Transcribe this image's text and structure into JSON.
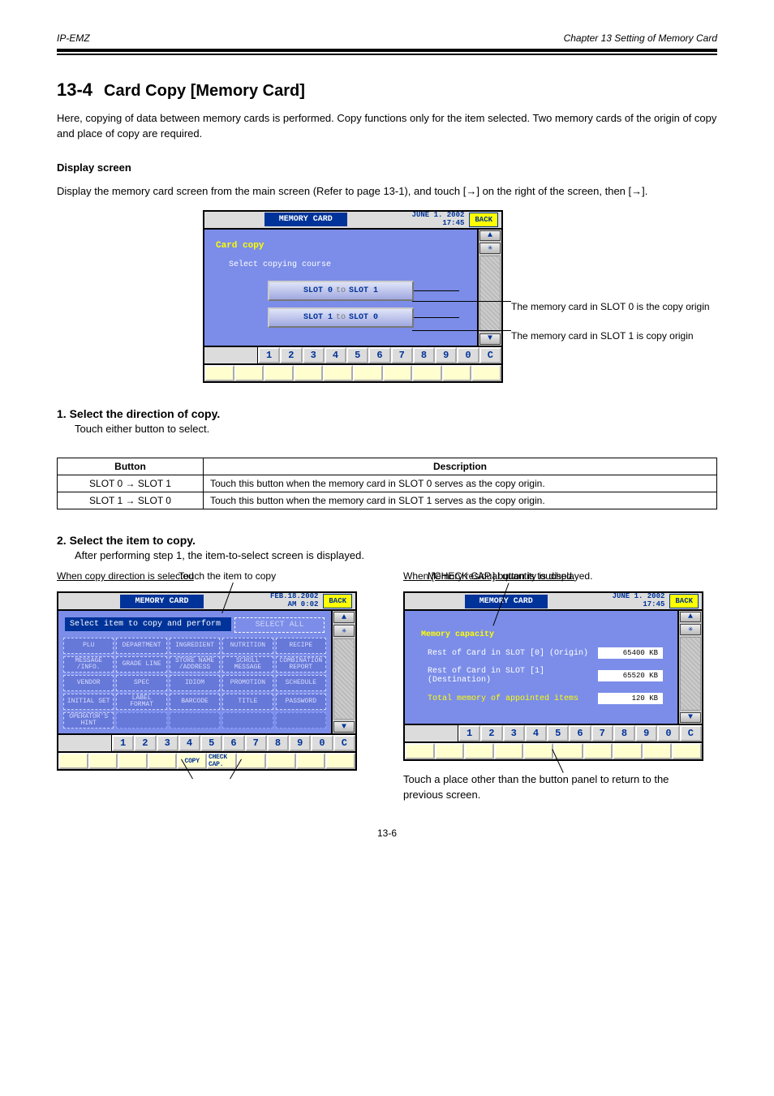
{
  "header": {
    "left": "IP-EMZ",
    "right": "Chapter 13   Setting of Memory Card"
  },
  "section": {
    "number": "13-4",
    "title": "Card Copy [Memory Card]"
  },
  "intro": {
    "p1": "Here, copying of data between memory cards is performed. Copy functions only for the item selected. Two memory cards of the origin of copy and place of copy are required.",
    "p2_prefix": "Display the memory card screen from the main screen (Refer to page 13-1), and touch [",
    "p2_arrow1": "→",
    "p2_mid": "] on the right of the screen, then [",
    "p2_arrow2": "→",
    "p2_suffix": "]."
  },
  "screen1": {
    "title": "MEMORY CARD",
    "date_line1": "JUNE 1. 2002",
    "date_line2": "17:45",
    "back": "BACK",
    "heading": "Card copy",
    "subheading": "Select copying course",
    "btn1_left": "SLOT 0",
    "btn_to": "to",
    "btn1_right": "SLOT 1",
    "btn2_left": "SLOT 1",
    "btn2_right": "SLOT 0",
    "callout1": "The memory card in SLOT 0 is the copy origin",
    "callout2": "The memory card in SLOT 1 is copy origin",
    "numpad": [
      "1",
      "2",
      "3",
      "4",
      "5",
      "6",
      "7",
      "8",
      "9",
      "0",
      "C"
    ]
  },
  "step1": {
    "heading": "1. Select the direction of copy.",
    "body": "Touch either button to select."
  },
  "desc_table": {
    "h1": "Button",
    "h2": "Description",
    "r1c1_a": "SLOT 0 ",
    "r1c1_arrow": "→",
    "r1c1_b": " SLOT 1",
    "r1c2": "Touch this button when the memory card in SLOT 0 serves as the copy origin.",
    "r2c1_a": "SLOT 1 ",
    "r2c1_arrow": "→",
    "r2c1_b": " SLOT 0",
    "r2c2": "Touch this button when the memory card in SLOT 1 serves as the copy origin."
  },
  "step2": {
    "heading": "2. Select the item to copy.",
    "body": "After performing step 1, the item-to-select screen is displayed."
  },
  "lower": {
    "left_caption": "When copy direction is selected",
    "left_note": "Touch the item to copy",
    "right_caption": "When [CHECK CAP.] button is touched.",
    "right_note": "Memory residual quantity is displayed.",
    "right_note2": "Touch a place other than the button panel to return to the previous screen."
  },
  "screenA": {
    "title": "MEMORY CARD",
    "date_line1": "FEB.18.2002",
    "date_line2": "AM 0:02",
    "back": "BACK",
    "instr": "Select item to copy and perform",
    "select_all": "SELECT ALL",
    "items": [
      "PLU",
      "DEPARTMENT",
      "INGREDIENT",
      "NUTRITION",
      "RECIPE",
      "MESSAGE /INFO.",
      "GRADE LINE",
      "STORE NAME /ADDRESS",
      "SCROLL MESSAGE",
      "COMBINATION REPORT",
      "VENDOR",
      "SPEC",
      "IDIOM",
      "PROMOTION",
      "SCHEDULE",
      "INITIAL SET",
      "LABEL FORMAT",
      "BARCODE",
      "TITLE",
      "PASSWORD",
      "OPERATOR'S HINT"
    ],
    "numpad": [
      "1",
      "2",
      "3",
      "4",
      "5",
      "6",
      "7",
      "8",
      "9",
      "0",
      "C"
    ],
    "soft_copy": "COPY",
    "soft_check": "CHECK CAP."
  },
  "screenB": {
    "title": "MEMORY CARD",
    "date_line1": "JUNE 1. 2002",
    "date_line2": "17:45",
    "back": "BACK",
    "header": "Memory capacity",
    "row1_lbl": "Rest of Card in SLOT [0] (Origin)",
    "row1_val": "65400 KB",
    "row2_lbl": "Rest of Card in SLOT [1] (Destination)",
    "row2_val": "65520 KB",
    "row3_lbl": "Total memory of appointed items",
    "row3_val": "120 KB",
    "numpad": [
      "1",
      "2",
      "3",
      "4",
      "5",
      "6",
      "7",
      "8",
      "9",
      "0",
      "C"
    ]
  },
  "footer": "13-6"
}
